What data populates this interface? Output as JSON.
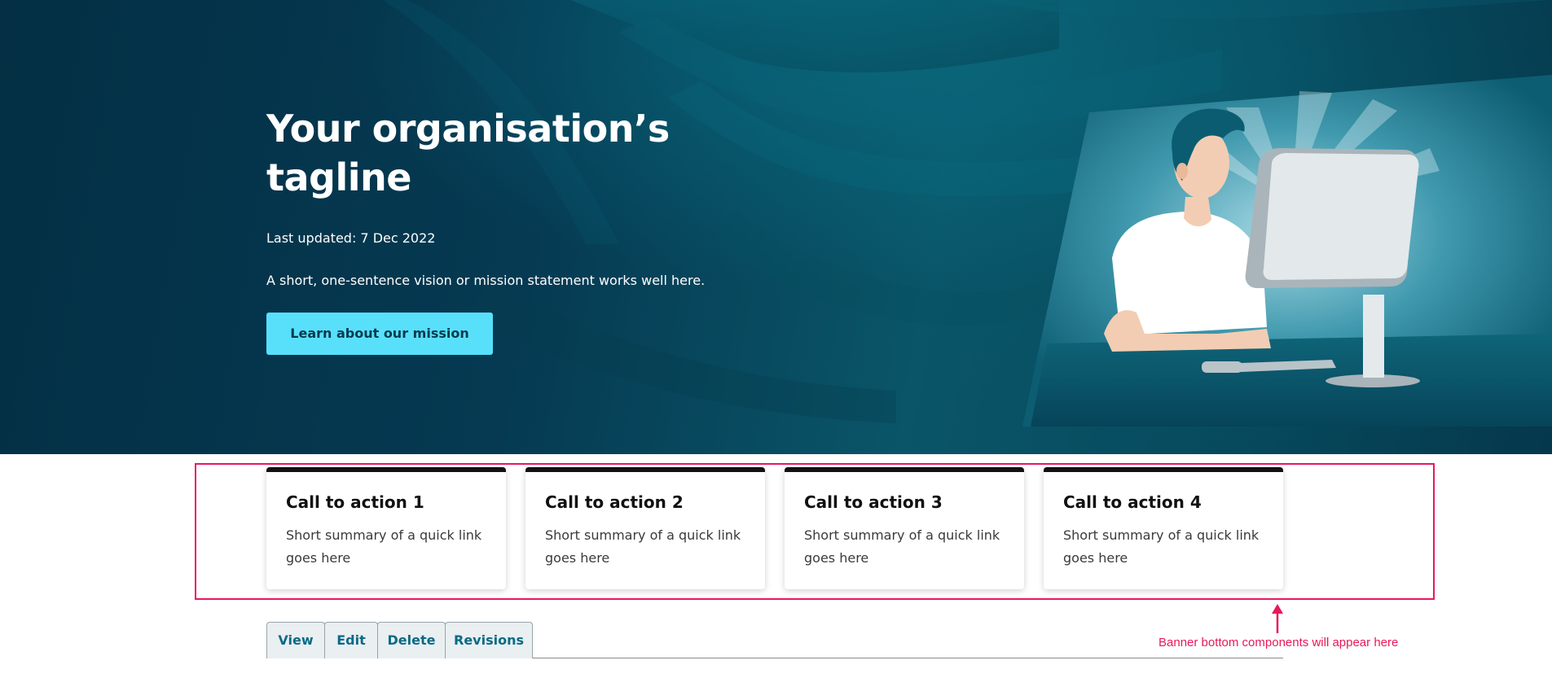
{
  "hero": {
    "title": "Your organisation’s tagline",
    "last_updated": "Last updated: 7 Dec 2022",
    "statement": "A short, one-sentence vision or mission statement works well here.",
    "button_label": "Learn about our mission",
    "illustration": "person-at-computer-illustration"
  },
  "cta_cards": [
    {
      "title": "Call to action 1",
      "summary": "Short summary of a quick link goes here"
    },
    {
      "title": "Call to action 2",
      "summary": "Short summary of a quick link goes here"
    },
    {
      "title": "Call to action 3",
      "summary": "Short summary of a quick link goes here"
    },
    {
      "title": "Call to action 4",
      "summary": "Short summary of a quick link goes here"
    }
  ],
  "tabs": [
    "View",
    "Edit",
    "Delete",
    "Revisions"
  ],
  "annotation": {
    "text": "Banner bottom components will appear here",
    "icon": "arrow-up-icon"
  },
  "colors": {
    "hero_background": "#053a52",
    "button_background": "#58e0fb",
    "annotation": "#e8195a",
    "tab_text": "#0a6a84",
    "card_top_border": "#111111"
  }
}
